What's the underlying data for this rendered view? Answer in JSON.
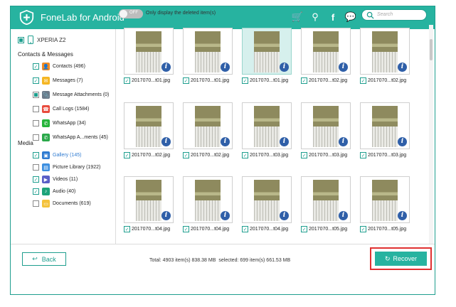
{
  "app": {
    "title": "FoneLab for Android"
  },
  "titlebar_icons": [
    "cart-icon",
    "key-icon",
    "facebook-icon",
    "chat-icon",
    "menu-icon",
    "minimize-icon",
    "maximize-icon",
    "close-icon"
  ],
  "titlebar_glyphs": {
    "cart": "🛒",
    "key": "⚲",
    "facebook": "f",
    "chat": "💬",
    "menu": "≡",
    "minimize": "—",
    "maximize": "□",
    "close": "✕"
  },
  "device": {
    "name": "XPERIA Z2"
  },
  "sidebar": {
    "contacts_section": "Contacts & Messages",
    "contacts_items": [
      {
        "label": "Contacts (496)",
        "checked": true,
        "color": "#f08a24",
        "glyph": "👤"
      },
      {
        "label": "Messages (7)",
        "checked": true,
        "color": "#f5b623",
        "glyph": "✉"
      },
      {
        "label": "Message Attachments (0)",
        "checked": "partial",
        "color": "#6c7a89",
        "glyph": "📎"
      },
      {
        "label": "Call Logs (1584)",
        "checked": false,
        "color": "#e84a3c",
        "glyph": "☎"
      },
      {
        "label": "WhatsApp (34)",
        "checked": false,
        "color": "#25b43a",
        "glyph": "✆"
      },
      {
        "label": "WhatsApp A...ments (45)",
        "checked": false,
        "color": "#2aa84a",
        "glyph": "✆"
      }
    ],
    "media_section": "Media",
    "media_items": [
      {
        "label": "Gallery (145)",
        "checked": true,
        "active": true,
        "color": "#2f7bd1",
        "glyph": "▣"
      },
      {
        "label": "Picture Library (1922)",
        "checked": false,
        "color": "#3d8fe0",
        "glyph": "▤"
      },
      {
        "label": "Videos (11)",
        "checked": true,
        "color": "#5a5fc7",
        "glyph": "▶"
      },
      {
        "label": "Audio (40)",
        "checked": true,
        "color": "#1ea37a",
        "glyph": "♪"
      },
      {
        "label": "Documents (619)",
        "checked": false,
        "color": "#f4c23b",
        "glyph": "▭"
      }
    ]
  },
  "toolbar": {
    "toggle_state": "OFF",
    "toggle_label": "Only display the deleted item(s)",
    "search_placeholder": "Search"
  },
  "grid": {
    "rows": [
      [
        "2017070...t01.jpg",
        "2017070...t01.jpg",
        "2017070...t01.jpg",
        "2017070...t02.jpg",
        "2017070...t02.jpg"
      ],
      [
        "2017070...t02.jpg",
        "2017070...t02.jpg",
        "2017070...t03.jpg",
        "2017070...t03.jpg",
        "2017070...t03.jpg"
      ],
      [
        "2017070...t04.jpg",
        "2017070...t04.jpg",
        "2017070...t04.jpg",
        "2017070...t05.jpg",
        "2017070...t05.jpg"
      ]
    ],
    "selected": [
      0,
      2
    ]
  },
  "footer": {
    "back_label": "Back",
    "total_label": "Total: 4903 item(s) 838.38 MB",
    "selected_label": "selected: 699 item(s) 661.53 MB",
    "recover_label": "Recover"
  },
  "colors": {
    "accent": "#27b3a0",
    "highlight": "#e03131",
    "info": "#2f5fa8"
  }
}
